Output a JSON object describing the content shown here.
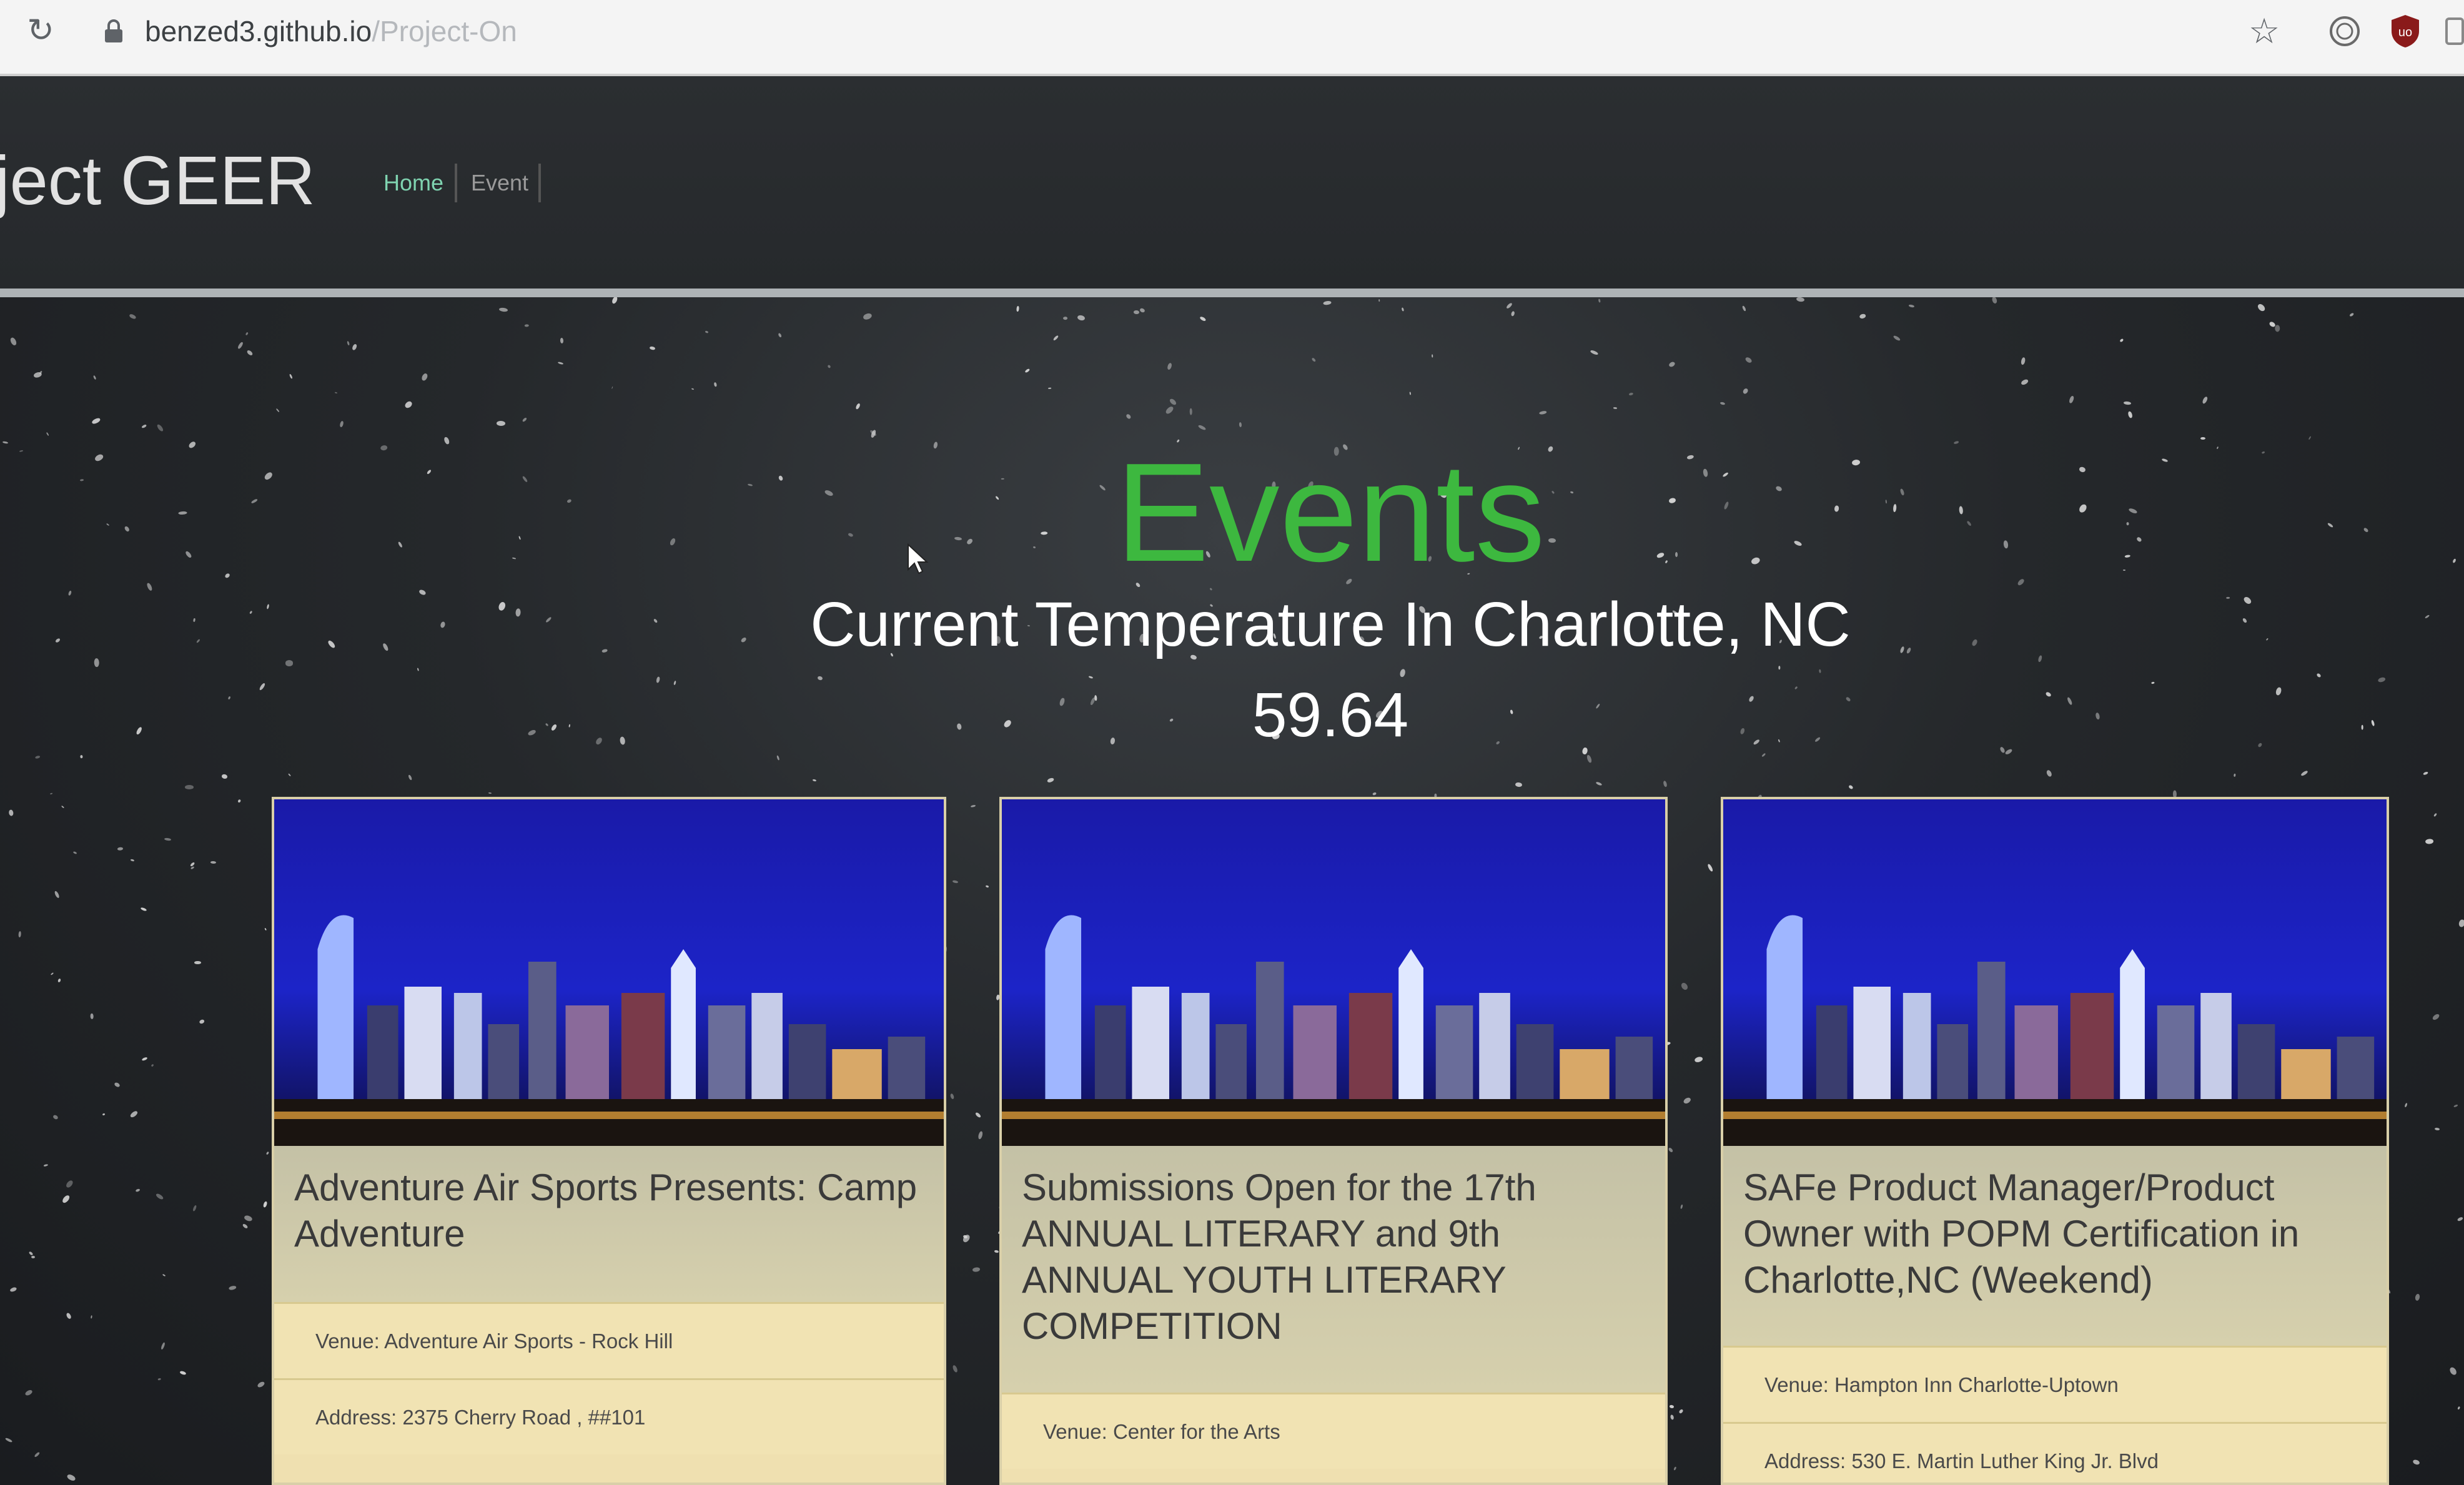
{
  "browser": {
    "url_main": "benzed3.github.io",
    "url_faded": "/Project-On"
  },
  "navbar": {
    "brand": "oject GEER",
    "links": [
      {
        "label": "Home"
      },
      {
        "label": "Event"
      }
    ]
  },
  "main": {
    "heading": "Events",
    "temperature_label": "Current Temperature In Charlotte, NC",
    "temperature_value": "59.64"
  },
  "events": [
    {
      "title": "Adventure Air Sports Presents: Camp Adventure",
      "venue": "Venue: Adventure Air Sports - Rock Hill",
      "address": "Address: 2375 Cherry Road , ##101"
    },
    {
      "title": "Submissions Open for the 17th ANNUAL LITERARY and 9th ANNUAL YOUTH LITERARY COMPETITION",
      "venue": "Venue: Center for the Arts"
    },
    {
      "title": "SAFe Product Manager/Product Owner with POPM Certification in Charlotte,NC (Weekend)",
      "venue": "Venue: Hampton Inn Charlotte-Uptown",
      "address": "Address: 530 E. Martin Luther King Jr. Blvd"
    }
  ],
  "colors": {
    "heading_green": "#3db83f",
    "nav_active": "#7fd3b0",
    "card_bg": "#efe0b0"
  },
  "icons": [
    "reload-icon",
    "lock-icon",
    "star-icon",
    "extension-icon",
    "ublock-icon",
    "cursor-icon"
  ]
}
